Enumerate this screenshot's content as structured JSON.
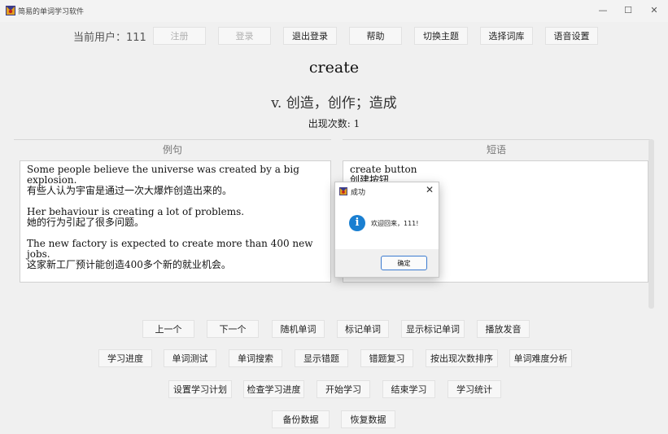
{
  "window": {
    "title": "简易的单词学习软件",
    "controls": {
      "minimize": "—",
      "maximize": "☐",
      "close": "✕"
    }
  },
  "header": {
    "current_user_label": "当前用户：111",
    "buttons": [
      "注册",
      "登录",
      "退出登录",
      "帮助",
      "切换主题",
      "选择词库",
      "语音设置"
    ]
  },
  "word": {
    "text": "create",
    "meaning": "v. 创造，创作；造成",
    "count_label": "出现次数: 1"
  },
  "examples": {
    "heading": "例句",
    "lines": [
      "Some people believe the universe was created by a big explosion.",
      "有些人认为宇宙是通过一次大爆炸创造出来的。",
      "Her behaviour is creating a lot of problems.",
      "她的行为引起了很多问题。",
      "The new factory is expected to create more than 400 new jobs.",
      "这家新工厂预计能创造400多个新的就业机会。"
    ]
  },
  "phrases": {
    "heading": "短语",
    "lines": [
      "create button",
      "创建按钮"
    ]
  },
  "dialog": {
    "title": "成功",
    "close": "✕",
    "icon": "info-icon",
    "icon_glyph": "i",
    "message": "欢迎回来，111!",
    "ok_label": "确定"
  },
  "bottom": {
    "row1": [
      "上一个",
      "下一个",
      "随机单词",
      "标记单词",
      "显示标记单词",
      "播放发音"
    ],
    "row2": [
      "学习进度",
      "单词测试",
      "单词搜索",
      "显示错题",
      "错题复习",
      "按出现次数排序",
      "单词难度分析"
    ],
    "row3": [
      "设置学习计划",
      "检查学习进度",
      "开始学习",
      "结束学习",
      "学习统计"
    ],
    "row4": [
      "备份数据",
      "恢复数据"
    ]
  },
  "colors": {
    "info_blue": "#1a7fd1",
    "ok_border": "#3c7bd0"
  }
}
